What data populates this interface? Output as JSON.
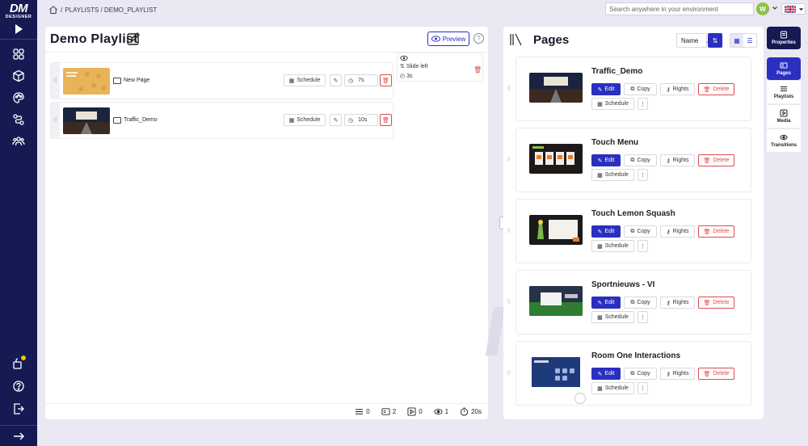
{
  "logo": {
    "line1": "DM",
    "line2": "DESIGNER"
  },
  "breadcrumb": {
    "sep": "/",
    "path": "PLAYLISTS / DEMO_PLAYLIST"
  },
  "search": {
    "placeholder": "Search anywhere in your environment"
  },
  "user": {
    "initial": "W"
  },
  "playlist": {
    "title": "Demo Playlist",
    "preview_label": "Preview",
    "help": "?",
    "items": [
      {
        "name": "New Page",
        "schedule_label": "Schedule",
        "duration": "7s"
      },
      {
        "name": "Traffic_Demo",
        "schedule_label": "Schedule",
        "duration": "10s"
      }
    ],
    "transition": {
      "effect": "Slide left",
      "time": "3s"
    },
    "stats": {
      "items": "0",
      "pages": "2",
      "media": "0",
      "transitions": "1",
      "total_time": "20s"
    }
  },
  "pages_panel": {
    "title": "Pages",
    "sort_label": "Name",
    "pages": [
      {
        "name": "Traffic_Demo",
        "edit": "Edit",
        "copy": "Copy",
        "rights": "Rights",
        "delete": "Delete",
        "schedule": "Schedule"
      },
      {
        "name": "Touch Menu",
        "edit": "Edit",
        "copy": "Copy",
        "rights": "Rights",
        "delete": "Delete",
        "schedule": "Schedule"
      },
      {
        "name": "Touch Lemon Squash",
        "edit": "Edit",
        "copy": "Copy",
        "rights": "Rights",
        "delete": "Delete",
        "schedule": "Schedule"
      },
      {
        "name": "Sportnieuws - VI",
        "edit": "Edit",
        "copy": "Copy",
        "rights": "Rights",
        "delete": "Delete",
        "schedule": "Schedule"
      },
      {
        "name": "Room One Interactions",
        "edit": "Edit",
        "copy": "Copy",
        "rights": "Rights",
        "delete": "Delete",
        "schedule": "Schedule"
      }
    ]
  },
  "right_tabs": [
    "Properties",
    "Pages",
    "Playlists",
    "Media",
    "Transitions"
  ],
  "colors": {
    "rail": "#161a52",
    "accent": "#2b2fbf",
    "danger": "#e24a4a"
  }
}
